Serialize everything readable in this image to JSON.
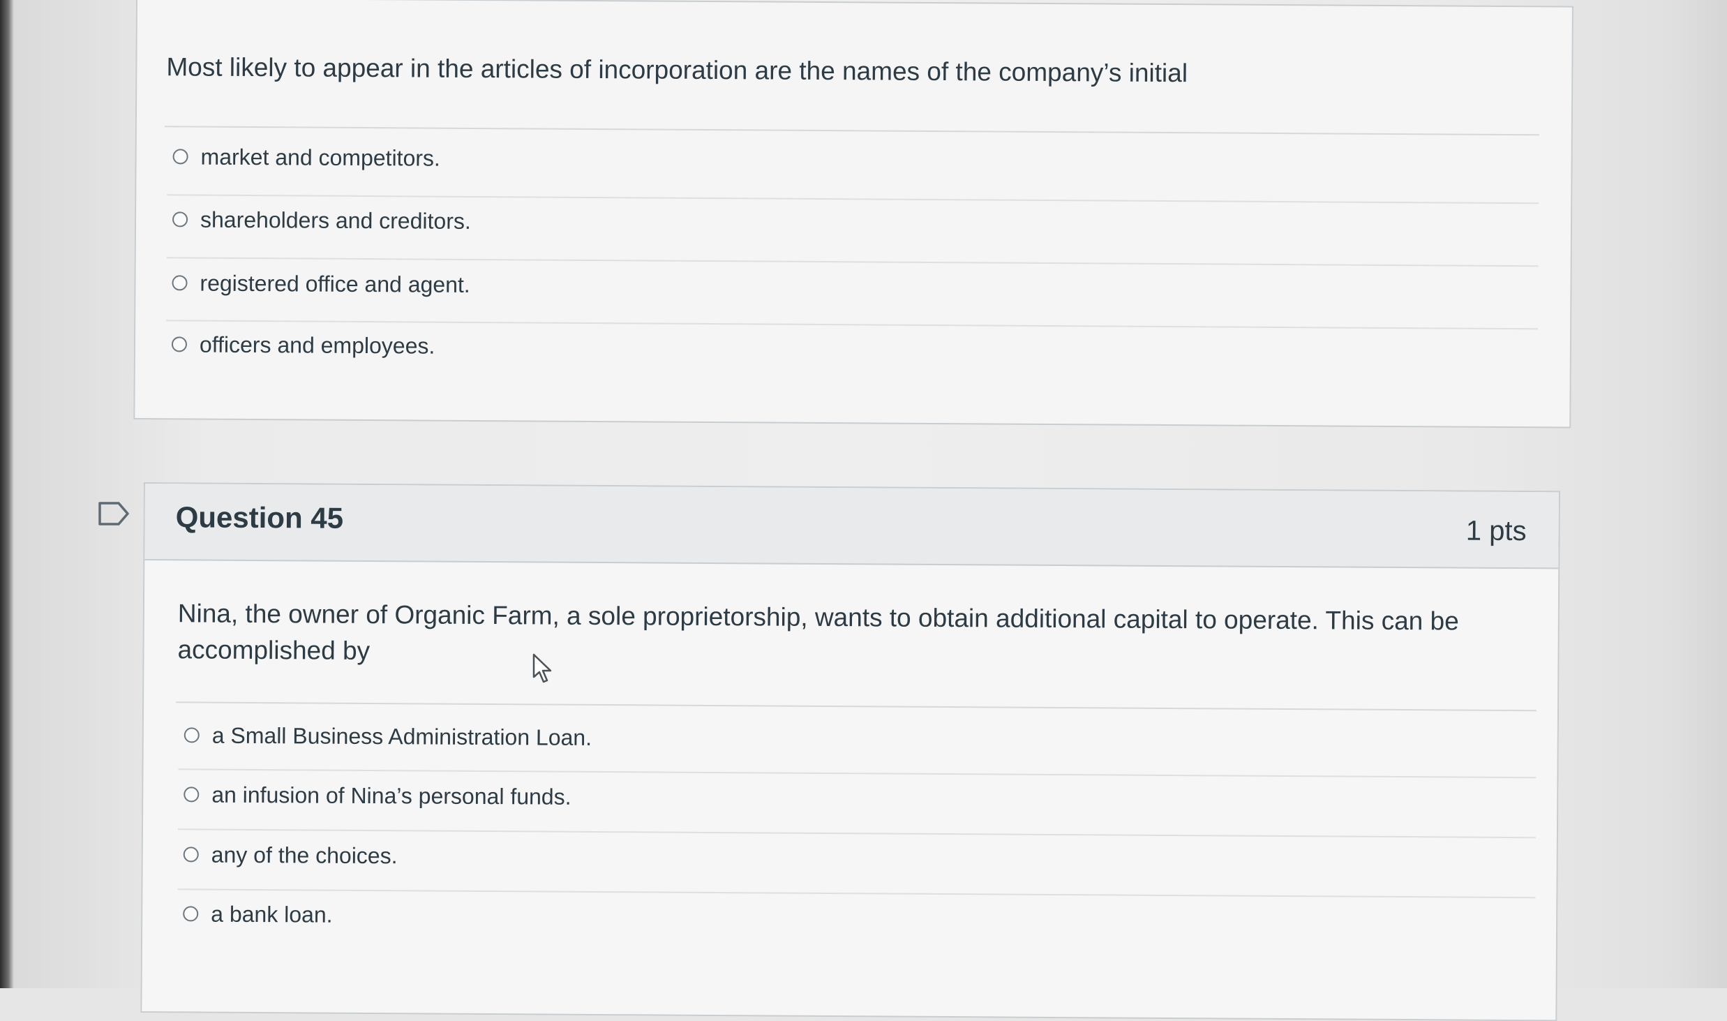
{
  "question_44": {
    "text": "Most likely to appear in the articles of incorporation are the names of the company’s initial",
    "answers": [
      {
        "label": "market and competitors."
      },
      {
        "label": "shareholders and creditors."
      },
      {
        "label": "registered office and agent."
      },
      {
        "label": "officers and employees."
      }
    ]
  },
  "question_45": {
    "title": "Question 45",
    "points": "1 pts",
    "text": "Nina, the owner of Organic Farm, a sole proprietorship, wants to obtain additional capital to operate. This can be accomplished by",
    "answers": [
      {
        "label": "a Small Business Administration Loan."
      },
      {
        "label": "an infusion of Nina’s personal funds."
      },
      {
        "label": "any of the choices."
      },
      {
        "label": "a bank loan."
      }
    ]
  },
  "icons": {
    "flag": "bookmark-flag-icon",
    "pointer": "mouse-pointer-icon"
  },
  "colors": {
    "text": "#2d3b45",
    "card_background": "#f5f5f5",
    "header_background": "#e9eaeb",
    "border": "#c7cdd1"
  }
}
